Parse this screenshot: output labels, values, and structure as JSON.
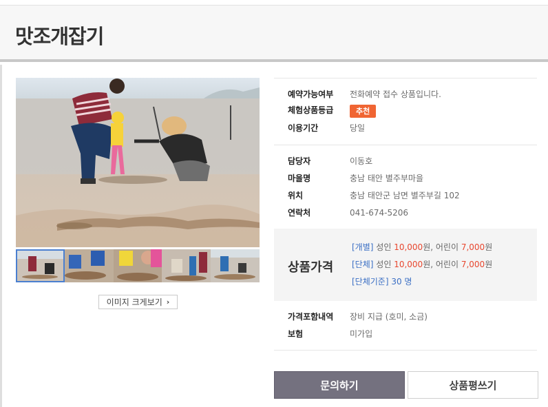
{
  "page": {
    "title": "맛조개잡기"
  },
  "gallery": {
    "thumbnail_count": 5,
    "view_large_label": "이미지 크게보기",
    "view_large_icon": "chevron-right-icon"
  },
  "info": {
    "group1": [
      {
        "key": "예약가능여부",
        "value": "전화예약 접수 상품입니다."
      },
      {
        "key": "체험상품등급",
        "badge": "추천",
        "badge_color": "#f06533"
      },
      {
        "key": "이용기간",
        "value": "당일"
      }
    ],
    "group2": [
      {
        "key": "담당자",
        "value": "이동호"
      },
      {
        "key": "마을명",
        "value": "충남 태안 별주부마을"
      },
      {
        "key": "위치",
        "value": "충남 태안군 남면 별주부길 102"
      },
      {
        "key": "연락처",
        "value": "041-674-5206"
      }
    ]
  },
  "price": {
    "title": "상품가격",
    "individual": {
      "tag": "[개별]",
      "adult_label": "성인",
      "adult_price": "10,000",
      "sep": "원, 어린이",
      "child_price": "7,000",
      "unit": "원"
    },
    "group": {
      "tag": "[단체]",
      "adult_label": "성인",
      "adult_price": "10,000",
      "sep": "원, 어린이",
      "child_price": "7,000",
      "unit": "원"
    },
    "group_criteria": "[단체기준] 30 명"
  },
  "extra": [
    {
      "key": "가격포함내역",
      "value": "장비 지급 (호미, 소금)"
    },
    {
      "key": "보험",
      "value": "미가입"
    }
  ],
  "buttons": {
    "inquiry": "문의하기",
    "review": "상품평쓰기"
  },
  "colors": {
    "badge": "#f06533",
    "price_red": "#e8462e",
    "tag_blue": "#3b6fc4",
    "inquiry_btn": "#74717f"
  }
}
